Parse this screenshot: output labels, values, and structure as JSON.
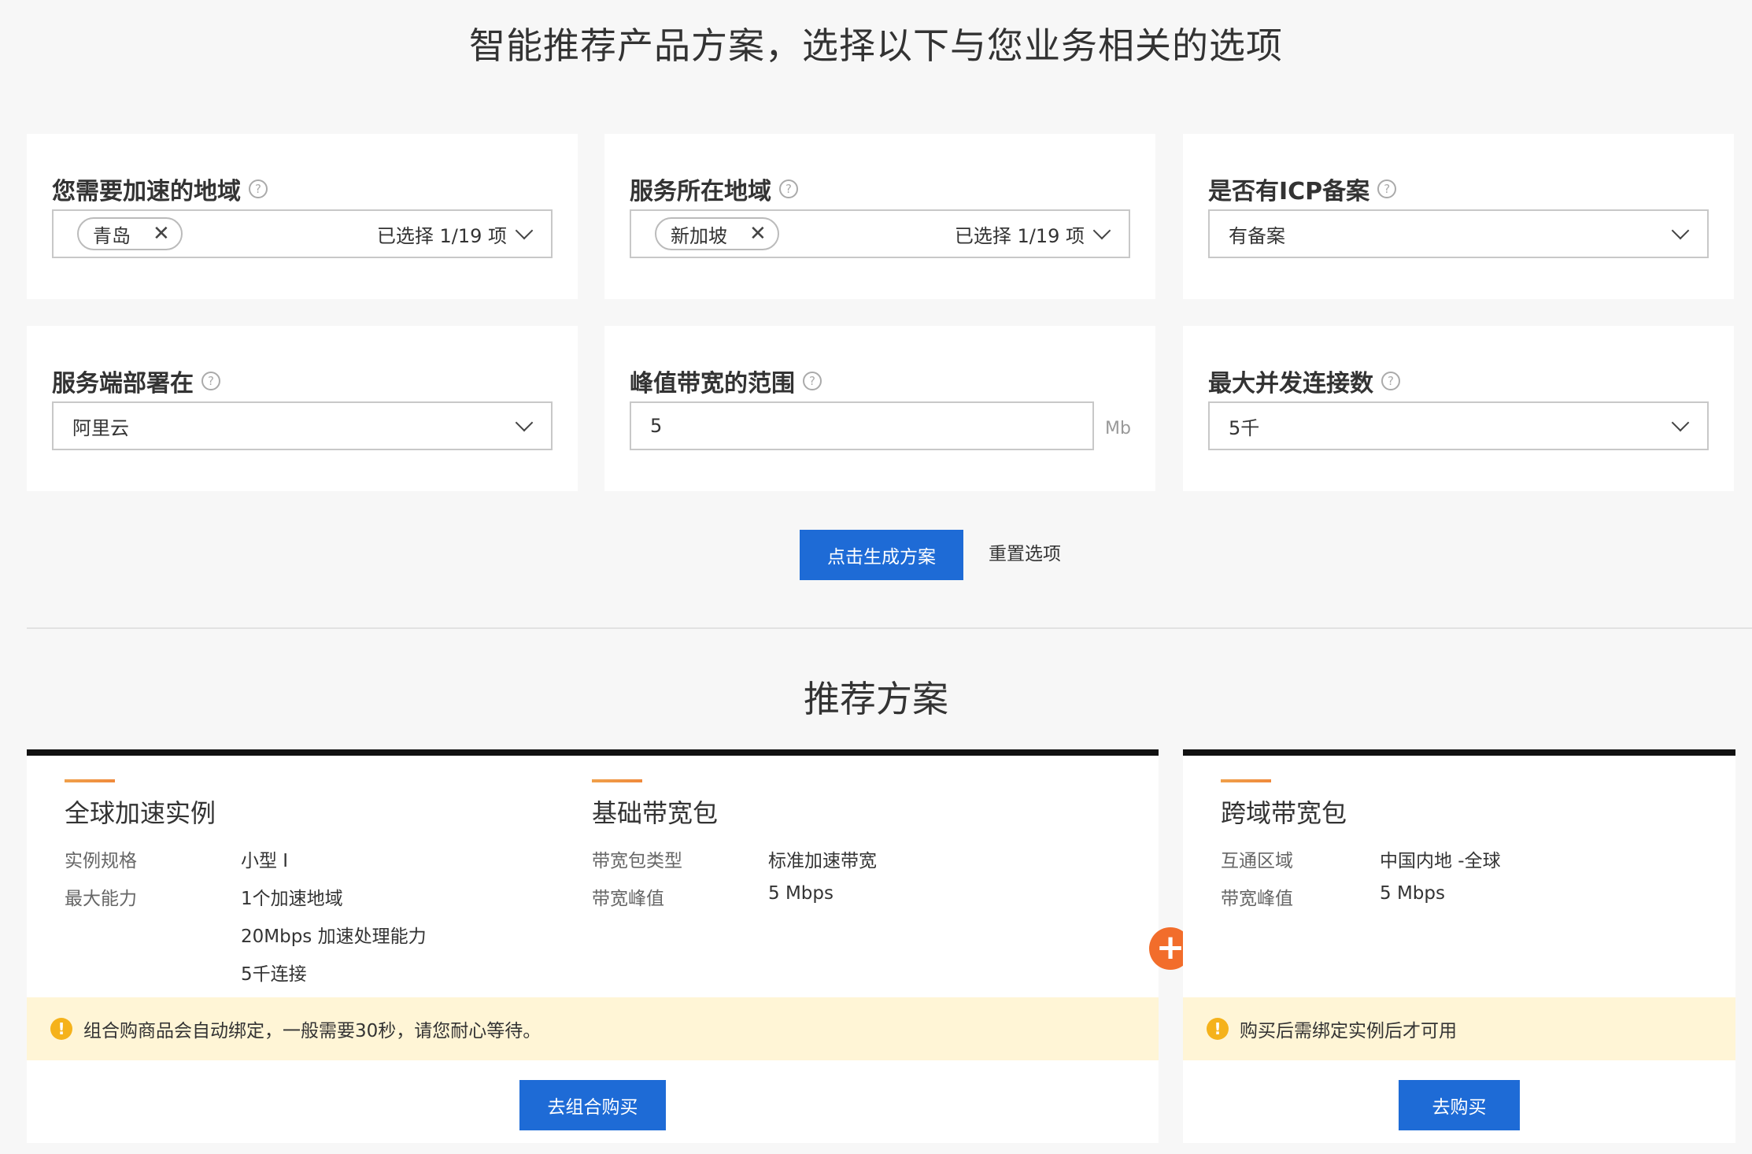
{
  "page": {
    "title": "智能推荐产品方案，选择以下与您业务相关的选项",
    "recommend_title": "推荐方案"
  },
  "form": {
    "accel_region": {
      "label": "您需要加速的地域",
      "tag": "青岛",
      "count": "已选择 1/19 项"
    },
    "service_region": {
      "label": "服务所在地域",
      "tag": "新加坡",
      "count": "已选择 1/19 项"
    },
    "icp": {
      "label": "是否有ICP备案",
      "value": "有备案"
    },
    "deploy": {
      "label": "服务端部署在",
      "value": "阿里云"
    },
    "bandwidth": {
      "label": "峰值带宽的范围",
      "value": "5",
      "unit": "Mb"
    },
    "connections": {
      "label": "最大并发连接数",
      "value": "5千"
    },
    "help_icon": "?",
    "generate_button": "点击生成方案",
    "reset_link": "重置选项"
  },
  "plan_combo": {
    "instance": {
      "name": "全球加速实例",
      "rows": [
        {
          "k": "实例规格",
          "v": "小型 I"
        },
        {
          "k": "最大能力",
          "v": "1个加速地域"
        },
        {
          "k": "",
          "v": "20Mbps 加速处理能力"
        },
        {
          "k": "",
          "v": "5千连接"
        }
      ]
    },
    "basic_bw": {
      "name": "基础带宽包",
      "rows": [
        {
          "k": "带宽包类型",
          "v": "标准加速带宽"
        },
        {
          "k": "带宽峰值",
          "v": "5 Mbps"
        }
      ]
    },
    "notice": "组合购商品会自动绑定，一般需要30秒，请您耐心等待。",
    "buy_button": "去组合购买"
  },
  "plan_cross": {
    "name": "跨域带宽包",
    "rows": [
      {
        "k": "互通区域",
        "v": "中国内地 -全球"
      },
      {
        "k": "带宽峰值",
        "v": "5 Mbps"
      }
    ],
    "notice": "购买后需绑定实例后才可用",
    "buy_button": "去购买"
  },
  "icons": {
    "plus": "plus-icon",
    "warn": "warning-icon",
    "close": "close-icon",
    "chevron": "chevron-down-icon"
  },
  "colors": {
    "primary": "#1e6bd6",
    "accent": "#f26d2b",
    "notice_bg": "#fff5d6"
  }
}
